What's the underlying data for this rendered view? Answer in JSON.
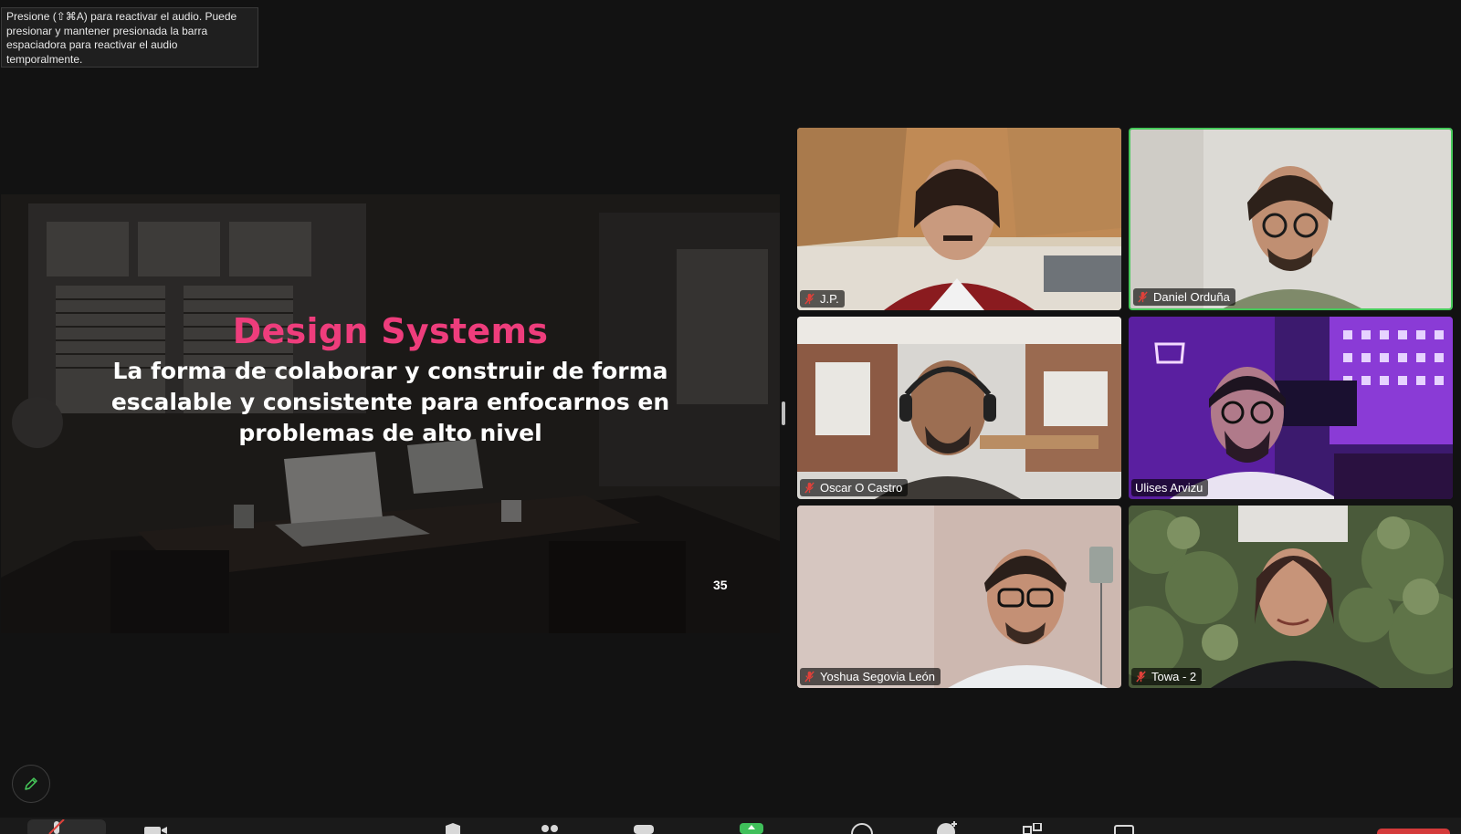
{
  "tooltip": {
    "text": "Presione  (⇧⌘A) para reactivar el audio. Puede presionar y mantener presionada la barra espaciadora para reactivar el audio temporalmente."
  },
  "slide": {
    "title": "Design Systems",
    "body": "La forma de colaborar y construir de forma escalable y consistente para enfocarnos en problemas de alto nivel",
    "page_number": "35"
  },
  "participants": [
    {
      "name": "J.P.",
      "muted": true,
      "active_speaker": false
    },
    {
      "name": "Daniel Orduña",
      "muted": true,
      "active_speaker": true
    },
    {
      "name": "Oscar O Castro",
      "muted": true,
      "active_speaker": false
    },
    {
      "name": "Ulises Arvizu",
      "muted": false,
      "active_speaker": false
    },
    {
      "name": "Yoshua Segovia León",
      "muted": true,
      "active_speaker": false
    },
    {
      "name": "Towa - 2",
      "muted": true,
      "active_speaker": false
    }
  ],
  "colors": {
    "background": "#121212",
    "slide_title": "#ee3d7c",
    "active_speaker_border": "#46c95a",
    "muted_icon": "#e0413a",
    "leave_button": "#d43a3a",
    "share_button": "#3fbf5a"
  },
  "toolbar": {
    "items": [
      "microphone-muted-icon",
      "video-camera-icon",
      "security-shield-icon",
      "participants-icon",
      "chat-icon",
      "share-screen-icon",
      "record-icon",
      "reactions-icon",
      "apps-icon",
      "whiteboard-icon"
    ]
  }
}
